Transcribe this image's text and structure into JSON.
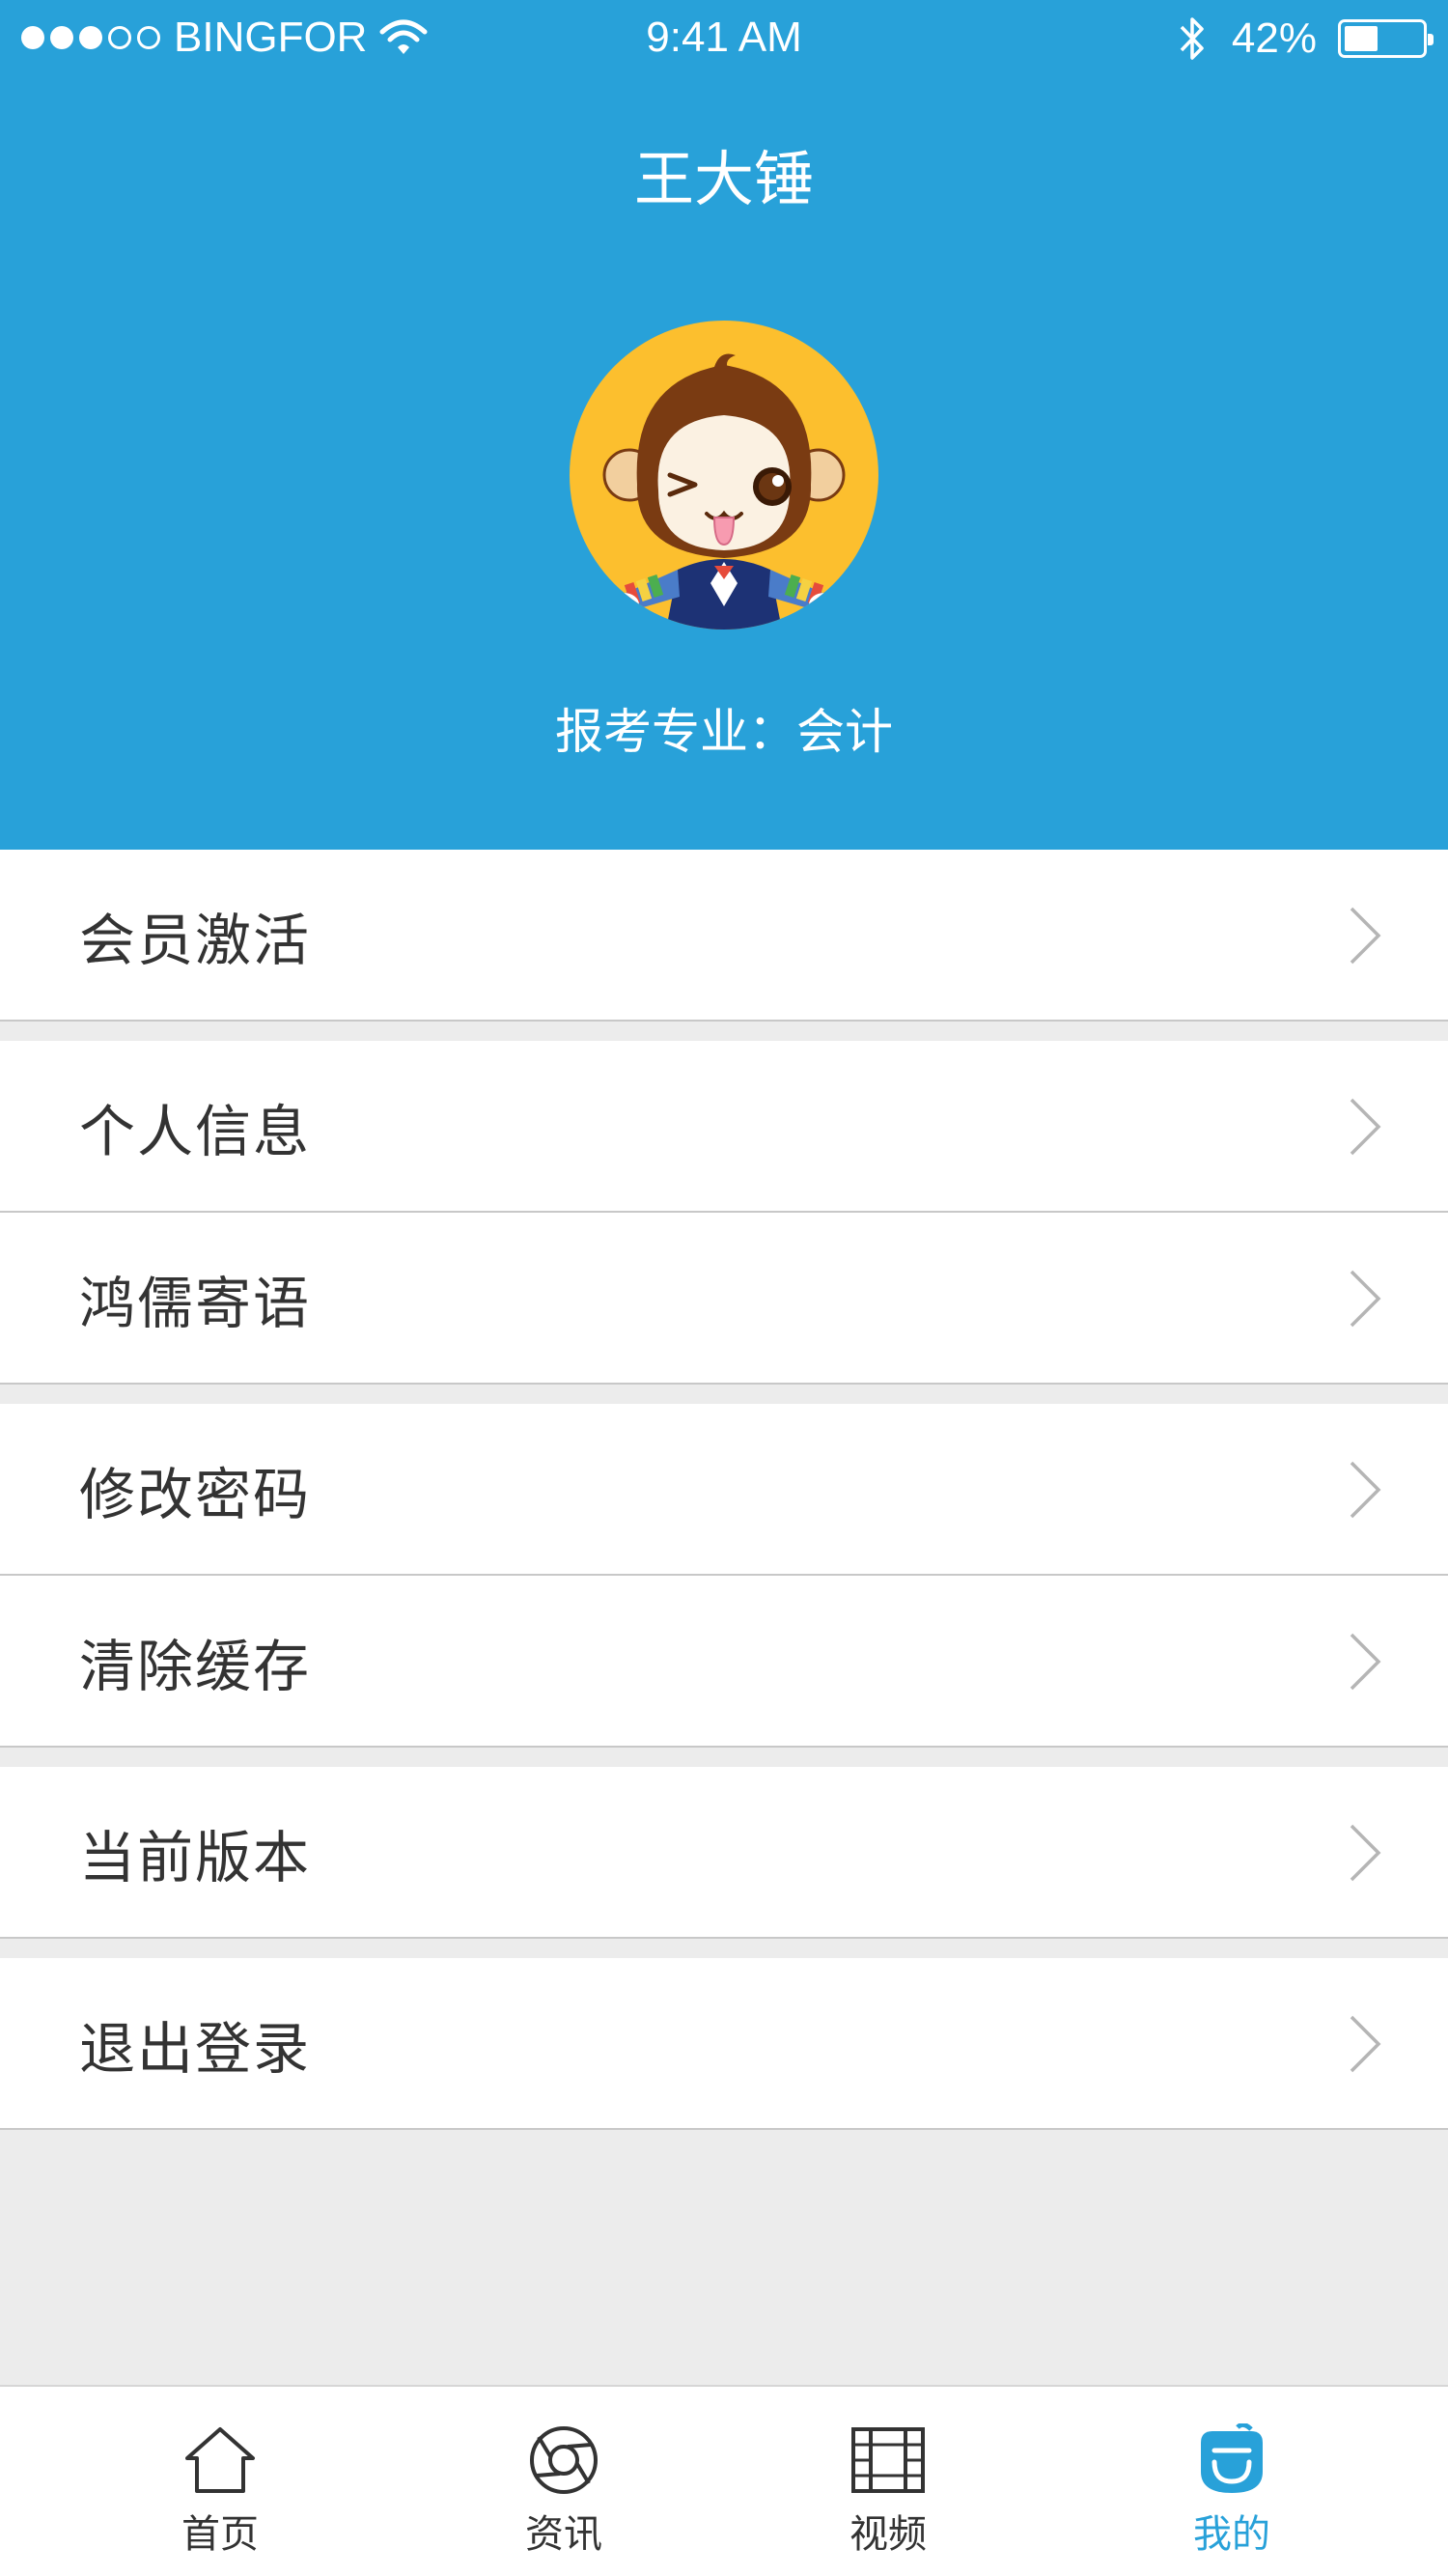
{
  "status_bar": {
    "carrier": "BINGFOR",
    "time": "9:41 AM",
    "battery": "42%",
    "signal_bars_filled": 3,
    "signal_bars_total": 5,
    "battery_level": 0.42
  },
  "profile": {
    "name": "王大锤",
    "major": "报考专业：会计",
    "avatar_icon": "monkey-cartoon-avatar"
  },
  "menu": {
    "items": [
      {
        "label": "会员激活"
      },
      {
        "label": "个人信息"
      },
      {
        "label": "鸿儒寄语"
      },
      {
        "label": "修改密码"
      },
      {
        "label": "清除缓存"
      },
      {
        "label": "当前版本"
      },
      {
        "label": "退出登录"
      }
    ]
  },
  "tabbar": {
    "tabs": [
      {
        "label": "首页",
        "icon": "home-icon",
        "active": false
      },
      {
        "label": "资讯",
        "icon": "news-icon",
        "active": false
      },
      {
        "label": "视频",
        "icon": "video-icon",
        "active": false
      },
      {
        "label": "我的",
        "icon": "profile-icon",
        "active": true
      }
    ]
  },
  "colors": {
    "accent": "#28a1d9",
    "background": "#ececec",
    "avatar_bg": "#fcbf2e"
  }
}
